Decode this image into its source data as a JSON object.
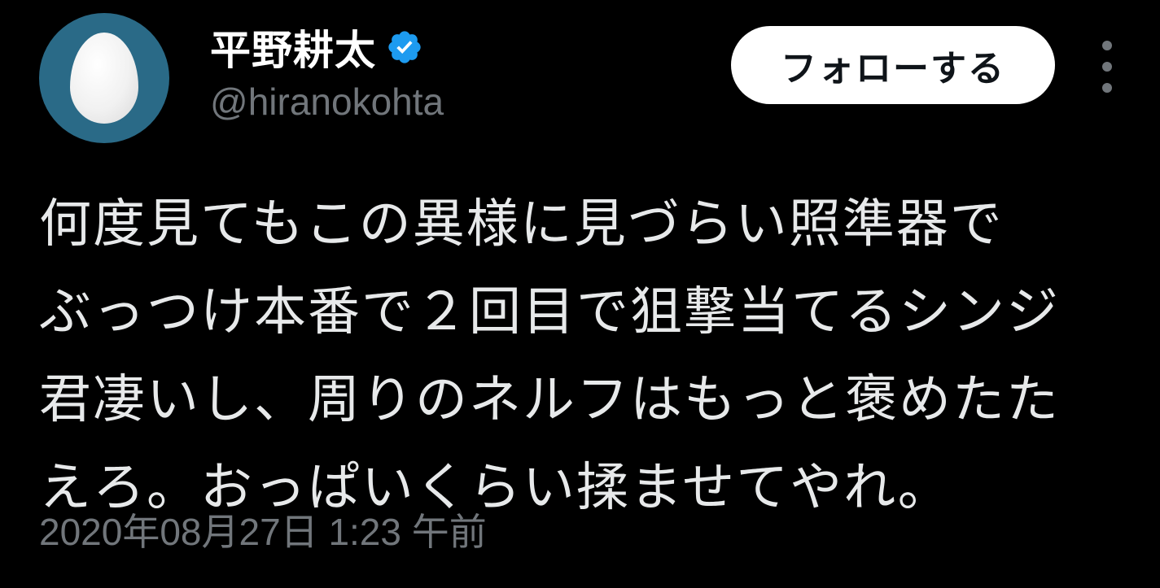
{
  "user": {
    "display_name": "平野耕太",
    "handle": "@hiranokohta",
    "avatar_icon": "default-egg-avatar",
    "verified_icon": "verified-badge-icon",
    "verified_color": "#1d9bf0"
  },
  "actions": {
    "follow_label": "フォローする",
    "more_icon": "more-vertical-icon"
  },
  "tweet": {
    "lines": [
      "何度見てもこの異様に見づらい照準器で",
      "ぶっつけ本番で２回目で狙撃当てるシンジ",
      "君凄いし、周りのネルフはもっと褒めたた",
      "えろ。おっぱいくらい揉ませてやれ。"
    ],
    "timestamp": "2020年08月27日 1:23 午前"
  },
  "colors": {
    "background": "#000000",
    "primary_text": "#e7e9ea",
    "secondary_text": "#71767b",
    "follow_button_bg": "#ffffff",
    "avatar_bg": "#2a6a87"
  }
}
